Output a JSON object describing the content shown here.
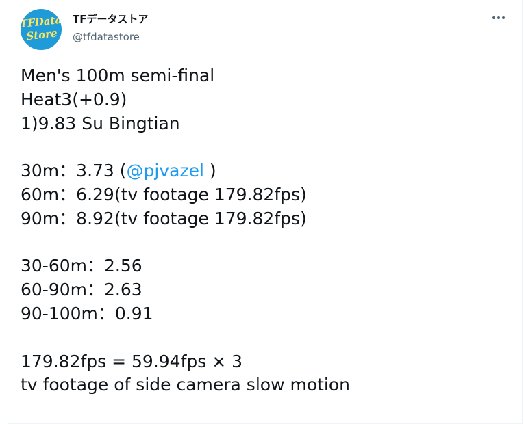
{
  "author": {
    "display_name": "TFデータストア",
    "handle": "@tfdatastore",
    "avatar_text_line1": "TFData",
    "avatar_text_line2": "Store",
    "avatar_bg_color": "#1e9bd8",
    "avatar_text_color": "#ffe45c"
  },
  "menu": {
    "icon": "more-horizontal-icon"
  },
  "tweet": {
    "lines": [
      "Men's 100m semi-final",
      "Heat3(+0.9)",
      "1)9.83 Su Bingtian",
      "",
      "30m：3.73 (",
      "60m：6.29(tv footage 179.82fps)",
      "90m：8.92(tv footage 179.82fps)",
      "",
      "30-60m：2.56",
      "60-90m：2.63",
      "90-100m：0.91",
      "",
      "179.82fps = 59.94fps × 3",
      "tv footage of side camera slow motion"
    ],
    "mention": "@pjvazel",
    "mention_suffix": " )",
    "mention_color": "#1d9bf0"
  }
}
